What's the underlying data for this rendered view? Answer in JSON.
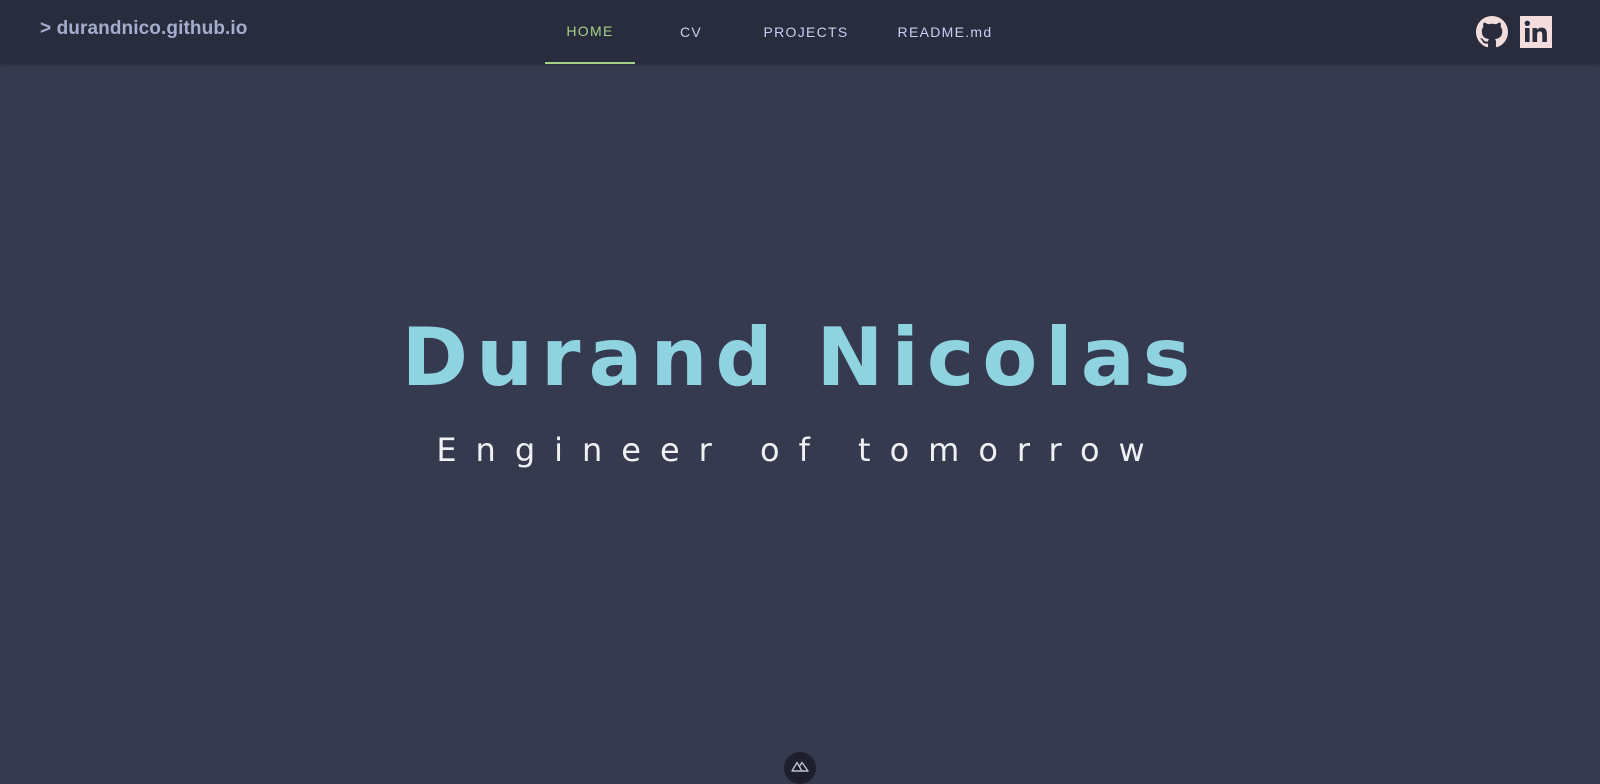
{
  "header": {
    "brand": "> durandnico.github.io",
    "nav": [
      {
        "label": "HOME",
        "active": true
      },
      {
        "label": "CV",
        "active": false
      },
      {
        "label": "PROJECTS",
        "active": false
      },
      {
        "label": "README.md",
        "active": false
      }
    ],
    "social": [
      {
        "icon": "github-icon"
      },
      {
        "icon": "linkedin-icon"
      }
    ]
  },
  "hero": {
    "name": "Durand Nicolas",
    "tagline": "Engineer of tomorrow"
  },
  "footer_badge": {
    "icon": "nuxt-logo-icon"
  },
  "colors": {
    "background": "#363a4f",
    "topbar": "#292c3c",
    "brand_text": "#a5adce",
    "nav_text": "#c6d0f5",
    "nav_active": "#a6d189",
    "hero_title": "#8fd3e0",
    "hero_subtitle": "#eff1f5",
    "social_icons": "#f2dcdc"
  }
}
